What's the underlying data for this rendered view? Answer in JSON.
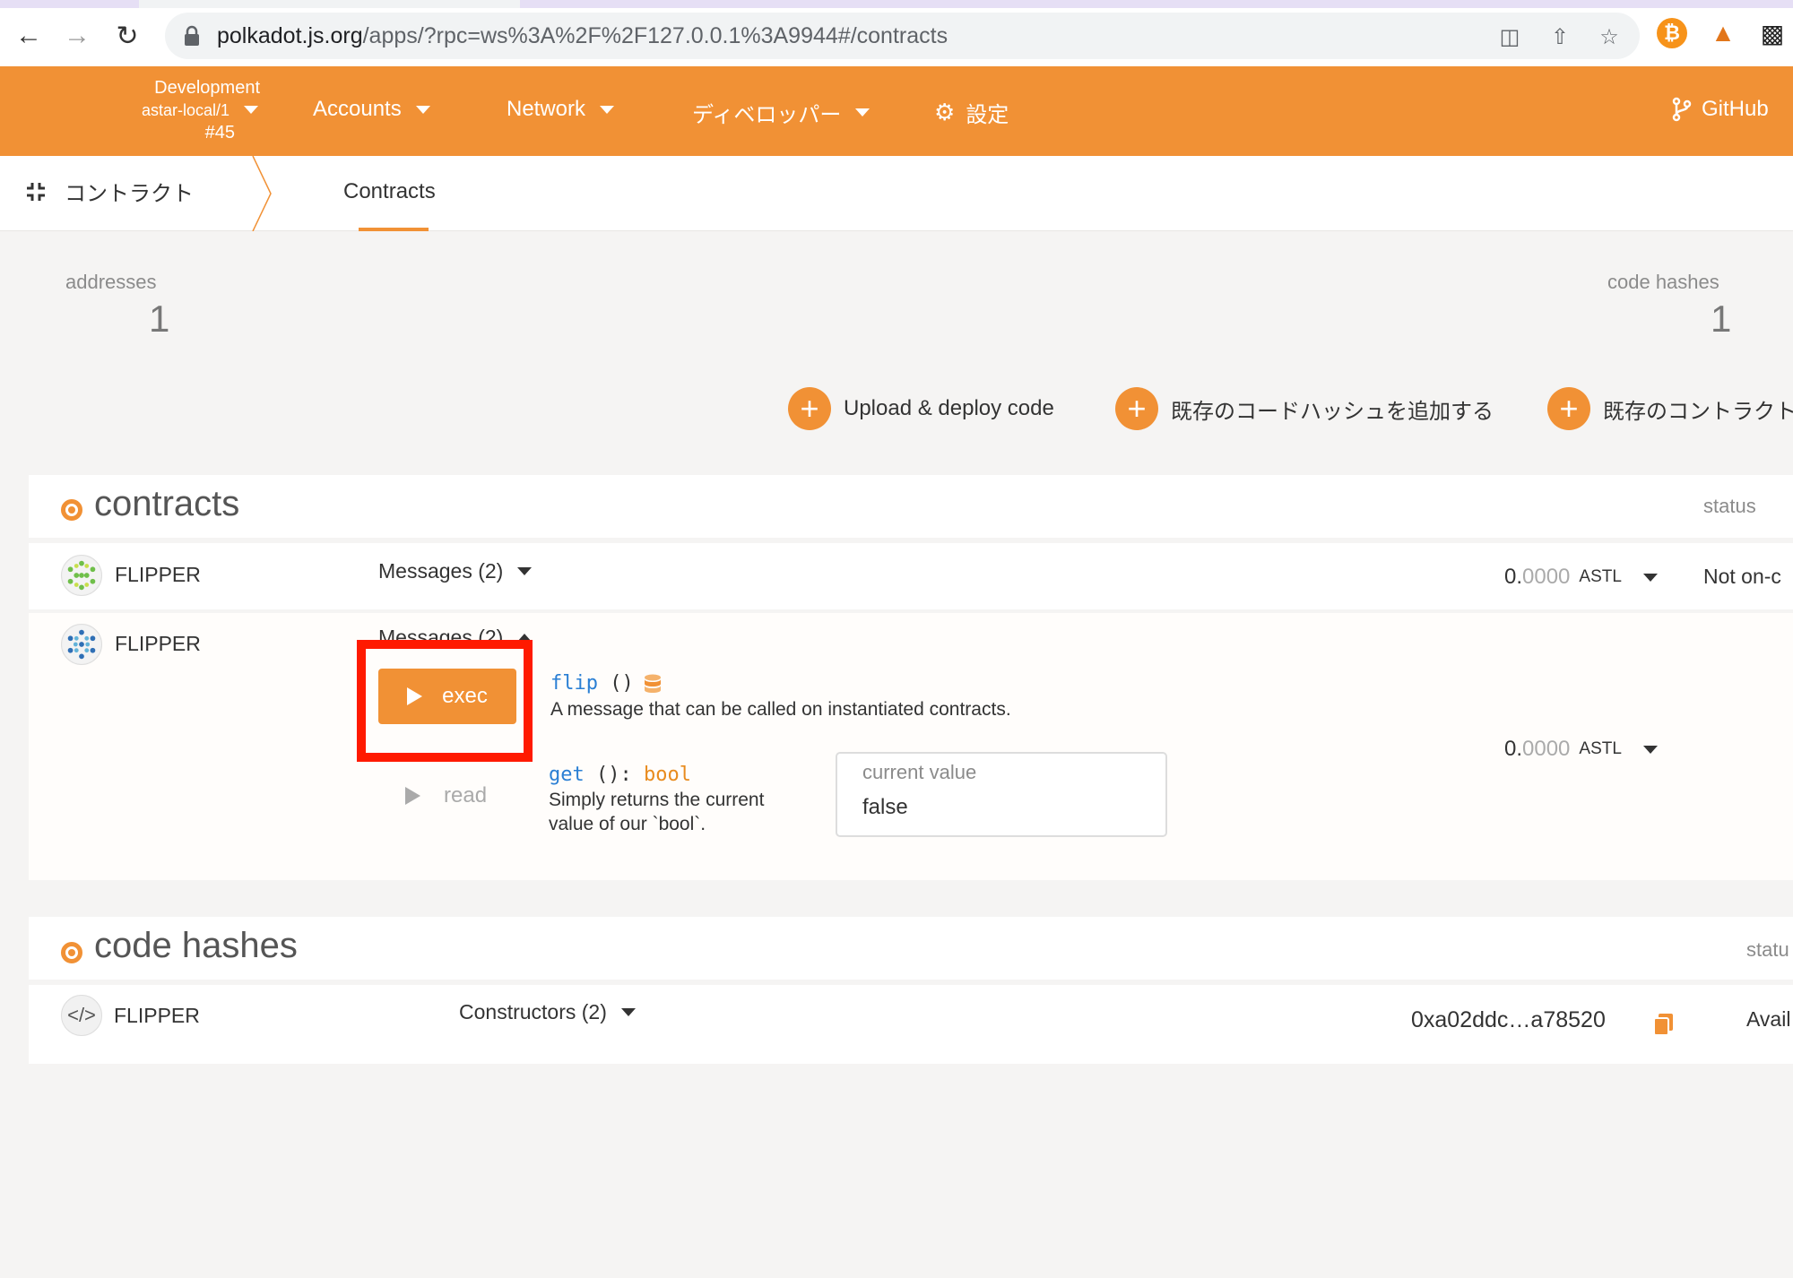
{
  "browser": {
    "url_host": "polkadot.js.org",
    "url_path": "/apps/?rpc=ws%3A%2F%2F127.0.0.1%3A9944#/contracts"
  },
  "appbar": {
    "chain_line1": "Development",
    "chain_line2": "astar-local/1",
    "chain_line3": "#45",
    "menu_accounts": "Accounts",
    "menu_network": "Network",
    "menu_developer": "ディベロッパー",
    "menu_settings": "設定",
    "menu_github": "GitHub"
  },
  "tabs": {
    "section": "コントラクト",
    "active": "Contracts"
  },
  "summary": {
    "addresses_label": "addresses",
    "addresses_value": "1",
    "codehashes_label": "code hashes",
    "codehashes_value": "1"
  },
  "actions": {
    "upload": "Upload & deploy code",
    "add_hash": "既存のコードハッシュを追加する",
    "add_contract": "既存のコントラクト"
  },
  "contracts_card": {
    "title": "contracts",
    "status_header": "status",
    "rows": [
      {
        "name": "FLIPPER",
        "messages": "Messages (2)",
        "balance_int": "0.",
        "balance_dec": "0000",
        "balance_unit": "ASTL",
        "status": "Not on-c"
      },
      {
        "name": "FLIPPER",
        "messages": "Messages (2)",
        "balance_int": "0.",
        "balance_dec": "0000",
        "balance_unit": "ASTL"
      }
    ],
    "exec_label": "exec",
    "read_label": "read",
    "flip_fn": "flip",
    "flip_args": "()",
    "flip_desc": "A message that can be called on instantiated contracts.",
    "get_fn": "get",
    "get_args": "():",
    "get_type": "bool",
    "get_desc_1": "Simply returns the current",
    "get_desc_2": "value of our `bool`.",
    "current_value_label": "current value",
    "current_value": "false"
  },
  "codehash_card": {
    "title": "code hashes",
    "status_header": "statu",
    "row_name": "FLIPPER",
    "constructors": "Constructors (2)",
    "hash": "0xa02ddc…a78520",
    "status": "Avail"
  },
  "colors": {
    "accent": "#f19135",
    "highlight": "#ff1a00"
  }
}
